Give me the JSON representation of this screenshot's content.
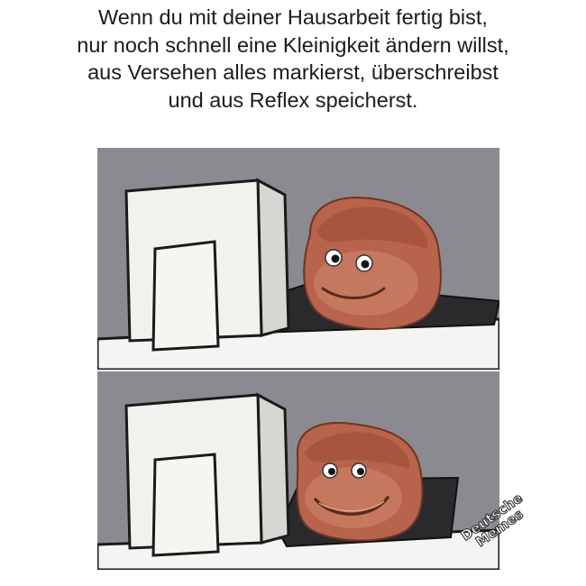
{
  "caption": {
    "lines": [
      "Wenn du mit deiner Hausarbeit fertig bist,",
      "nur noch schnell eine Kleinigkeit ändern willst,",
      "aus Versehen alles markierst, überschreibst",
      "und aus Reflex speicherst."
    ]
  },
  "panels": [
    {
      "expression": "calm-smile"
    },
    {
      "expression": "nervous-smile"
    }
  ],
  "watermark": {
    "lines": [
      "Deutsche",
      "Memes"
    ]
  },
  "colors": {
    "background": "#ffffff",
    "panel_bg": "#8a8a90",
    "monitor": "#f1f1ee",
    "outline": "#1a1a1a",
    "bread": "#b8634b"
  }
}
